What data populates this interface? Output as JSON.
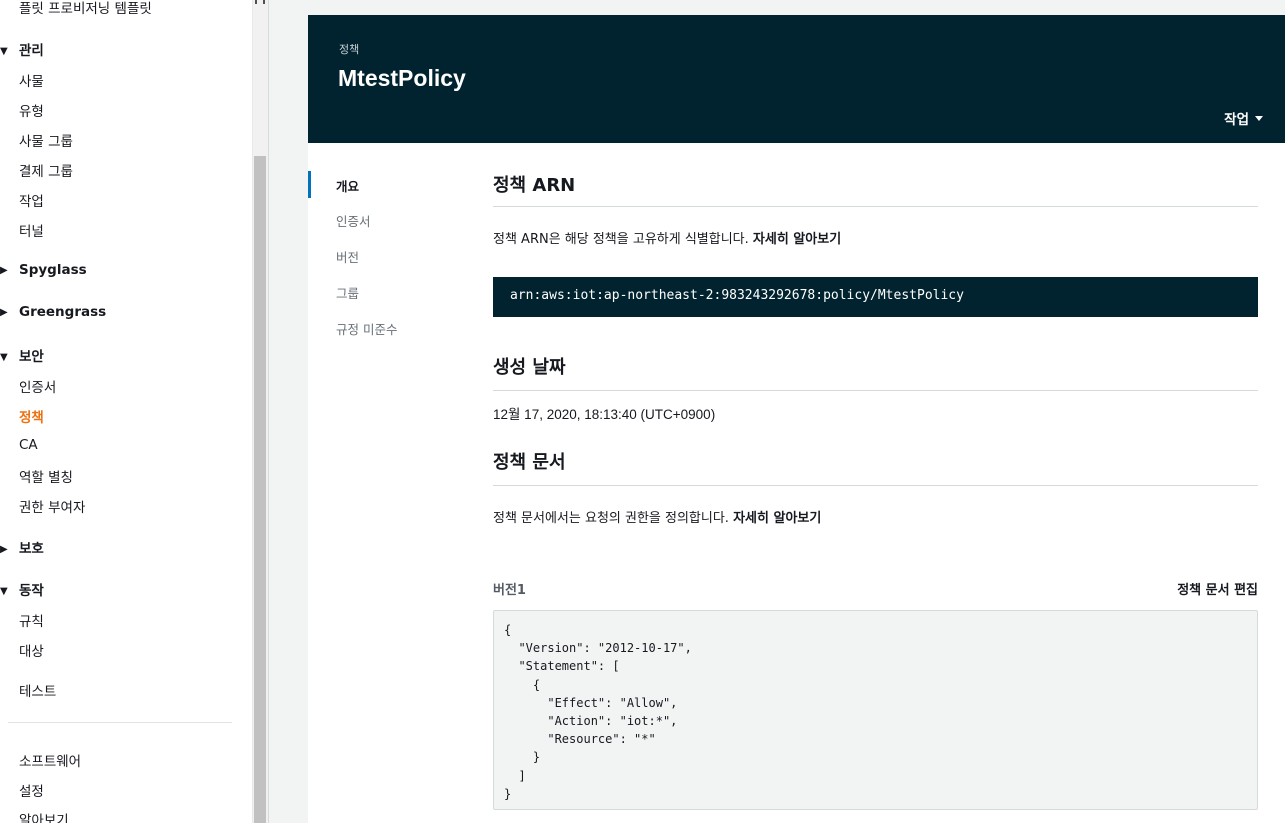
{
  "sidebar": {
    "top_cut_item": "플릿 프로비저닝 템플릿",
    "sections": [
      {
        "label": "관리",
        "expanded": true
      },
      {
        "label": "Spyglass",
        "expanded": false
      },
      {
        "label": "Greengrass",
        "expanded": false
      },
      {
        "label": "보안",
        "expanded": true
      },
      {
        "label": "보호",
        "expanded": false
      },
      {
        "label": "동작",
        "expanded": true
      }
    ],
    "manage_items": [
      "사물",
      "유형",
      "사물 그룹",
      "결제 그룹",
      "작업",
      "터널"
    ],
    "security_items": [
      "인증서",
      "정책",
      "CA",
      "역할 별칭",
      "권한 부여자"
    ],
    "active_item": "정책",
    "act_items": [
      "규칙",
      "대상"
    ],
    "test_item": "테스트",
    "bottom_items": [
      "소프트웨어",
      "설정",
      "알아보기"
    ]
  },
  "header": {
    "crumb": "정책",
    "title": "MtestPolicy",
    "actions_label": "작업"
  },
  "tabs": [
    "개요",
    "인증서",
    "버전",
    "그룹",
    "규정 미준수"
  ],
  "active_tab": "개요",
  "arn_section": {
    "title": "정책 ARN",
    "description": "정책 ARN은 해당 정책을 고유하게 식별합니다.",
    "learn_more": "자세히 알아보기",
    "arn": "arn:aws:iot:ap-northeast-2:983243292678:policy/MtestPolicy"
  },
  "created_section": {
    "title": "생성 날짜",
    "value": "12월 17, 2020, 18:13:40 (UTC+0900)"
  },
  "document_section": {
    "title": "정책 문서",
    "description": "정책 문서에서는 요청의 권한을 정의합니다.",
    "learn_more": "자세히 알아보기",
    "version_label": "버전1",
    "edit_label": "정책 문서 편집",
    "document": "{\n  \"Version\": \"2012-10-17\",\n  \"Statement\": [\n    {\n      \"Effect\": \"Allow\",\n      \"Action\": \"iot:*\",\n      \"Resource\": \"*\"\n    }\n  ]\n}"
  },
  "colors": {
    "header_bg": "#00232f",
    "active_nav": "#ec7211",
    "tab_indicator": "#0073bb"
  }
}
